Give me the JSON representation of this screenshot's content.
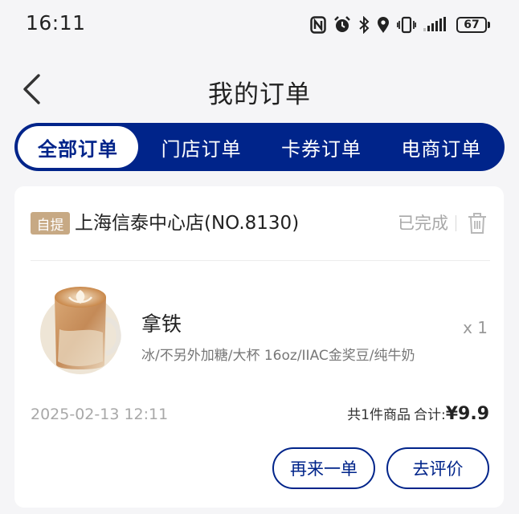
{
  "status_bar": {
    "time": "16:11",
    "battery": "67",
    "icons": [
      "nfc-icon",
      "alarm-icon",
      "bluetooth-icon",
      "location-icon",
      "vibrate-icon",
      "signal-icon",
      "battery-icon"
    ]
  },
  "header": {
    "title": "我的订单",
    "back_icon": "chevron-left-icon"
  },
  "tabs": [
    {
      "label": "全部订单",
      "active": true
    },
    {
      "label": "门店订单",
      "active": false
    },
    {
      "label": "卡券订单",
      "active": false
    },
    {
      "label": "电商订单",
      "active": false
    }
  ],
  "order": {
    "pickup_badge": "自提",
    "store_name": "上海信泰中心店(NO.8130)",
    "status": "已完成",
    "delete_icon": "trash-icon",
    "product": {
      "name": "拿铁",
      "specs": "冰/不另外加糖/大杯 16oz/IIAC金奖豆/纯牛奶",
      "quantity": "x 1"
    },
    "time": "2025-02-13 12:11",
    "item_count": "共1件商品",
    "total_label": "合计:",
    "total_amount": "¥9.9",
    "buttons": {
      "reorder": "再来一单",
      "review": "去评价"
    }
  },
  "colors": {
    "brand": "#00248a",
    "badge": "#c7a984",
    "background": "#f5f5f7"
  }
}
